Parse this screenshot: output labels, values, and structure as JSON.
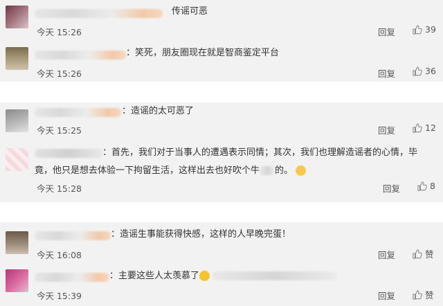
{
  "comments": [
    {
      "text": "传谣可恶",
      "time": "今天 15:26",
      "reply": "回复",
      "likes": "39"
    },
    {
      "text": "：笑死，朋友圈现在就是智商鉴定平台",
      "time": "今天 15:26",
      "reply": "回复",
      "likes": "36"
    },
    {
      "text": "：造谣的太可恶了",
      "time": "今天 15:25",
      "reply": "回复",
      "likes": "12"
    },
    {
      "text_line1": "：首先，我们对于当事人的遭遇表示同情；其次，我们也理解造谣者的心情，毕",
      "text_line2_a": "竟，他只是想去体验一下拘留生活，这样出去也好吹个牛",
      "text_line2_b": "的。",
      "time": "今天 15:28",
      "reply": "回复",
      "likes": "8"
    },
    {
      "text": "：造谣生事能获得快感，这样的人早晚完蛋！",
      "time": "今天 16:08",
      "reply": "回复",
      "likes": "赞"
    },
    {
      "text": "：主要这些人太羡慕了",
      "time": "今天 15:39",
      "reply": "回复",
      "likes": "赞"
    }
  ],
  "icons": {
    "like": "thumbs-up-icon",
    "emoji_cat": "cat-face-emoji",
    "emoji_laugh": "laughing-emoji"
  }
}
